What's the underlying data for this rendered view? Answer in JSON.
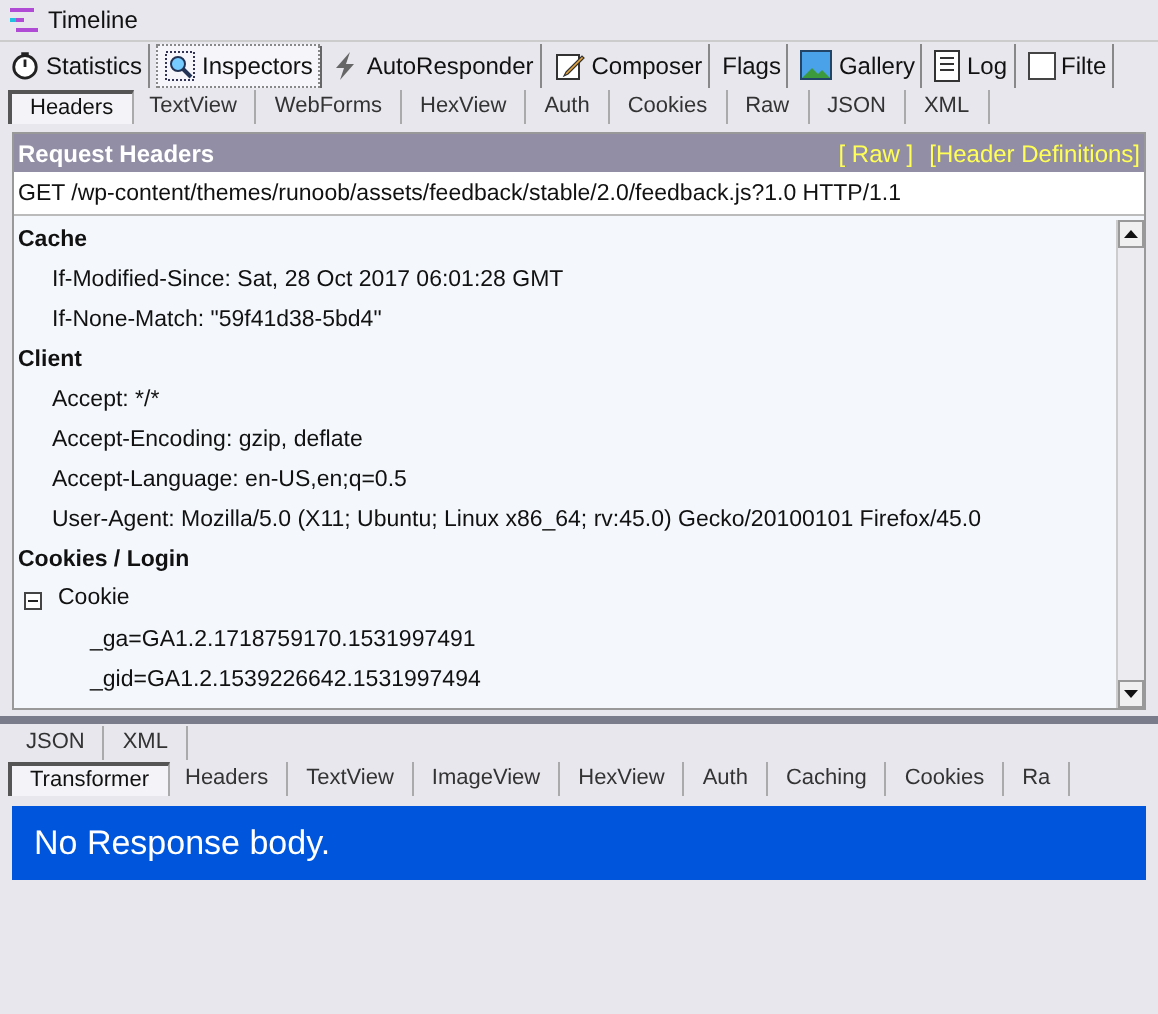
{
  "timeline": {
    "title": "Timeline"
  },
  "tabs": [
    {
      "label": "Statistics",
      "selected": false
    },
    {
      "label": "Inspectors",
      "selected": true
    },
    {
      "label": "AutoResponder",
      "selected": false
    },
    {
      "label": "Composer",
      "selected": false
    },
    {
      "label": "Flags",
      "selected": false
    },
    {
      "label": "Gallery",
      "selected": false
    },
    {
      "label": "Log",
      "selected": false
    },
    {
      "label": "Filte",
      "selected": false
    }
  ],
  "request_tabs": [
    {
      "label": "Headers",
      "selected": true
    },
    {
      "label": "TextView",
      "selected": false
    },
    {
      "label": "WebForms",
      "selected": false
    },
    {
      "label": "HexView",
      "selected": false
    },
    {
      "label": "Auth",
      "selected": false
    },
    {
      "label": "Cookies",
      "selected": false
    },
    {
      "label": "Raw",
      "selected": false
    },
    {
      "label": "JSON",
      "selected": false
    },
    {
      "label": "XML",
      "selected": false
    }
  ],
  "request_headers": {
    "title": "Request Headers",
    "links": [
      "[ Raw ]",
      "[Header Definitions]"
    ],
    "request_line": "GET /wp-content/themes/runoob/assets/feedback/stable/2.0/feedback.js?1.0 HTTP/1.1",
    "groups": [
      {
        "name": "Cache",
        "headers": [
          {
            "text": "If-Modified-Since: Sat, 28 Oct 2017 06:01:28 GMT"
          },
          {
            "text": "If-None-Match: \"59f41d38-5bd4\""
          }
        ]
      },
      {
        "name": "Client",
        "headers": [
          {
            "text": "Accept: */*"
          },
          {
            "text": "Accept-Encoding: gzip, deflate"
          },
          {
            "text": "Accept-Language: en-US,en;q=0.5"
          },
          {
            "text": "User-Agent: Mozilla/5.0 (X11; Ubuntu; Linux x86_64; rv:45.0) Gecko/20100101 Firefox/45.0"
          }
        ]
      },
      {
        "name": "Cookies / Login",
        "headers": [
          {
            "text": "Cookie",
            "expanded": true,
            "children": [
              {
                "text": "_ga=GA1.2.1718759170.1531997491"
              },
              {
                "text": "_gid=GA1.2.1539226642.1531997494"
              }
            ]
          }
        ]
      }
    ]
  },
  "request_subtabs": [
    {
      "label": "JSON",
      "selected": false
    },
    {
      "label": "XML",
      "selected": false
    }
  ],
  "response_tabs": [
    {
      "label": "Transformer",
      "selected": true
    },
    {
      "label": "Headers",
      "selected": false
    },
    {
      "label": "TextView",
      "selected": false
    },
    {
      "label": "ImageView",
      "selected": false
    },
    {
      "label": "HexView",
      "selected": false
    },
    {
      "label": "Auth",
      "selected": false
    },
    {
      "label": "Caching",
      "selected": false
    },
    {
      "label": "Cookies",
      "selected": false
    },
    {
      "label": "Ra",
      "selected": false
    }
  ],
  "response_body": {
    "message": "No Response body."
  }
}
